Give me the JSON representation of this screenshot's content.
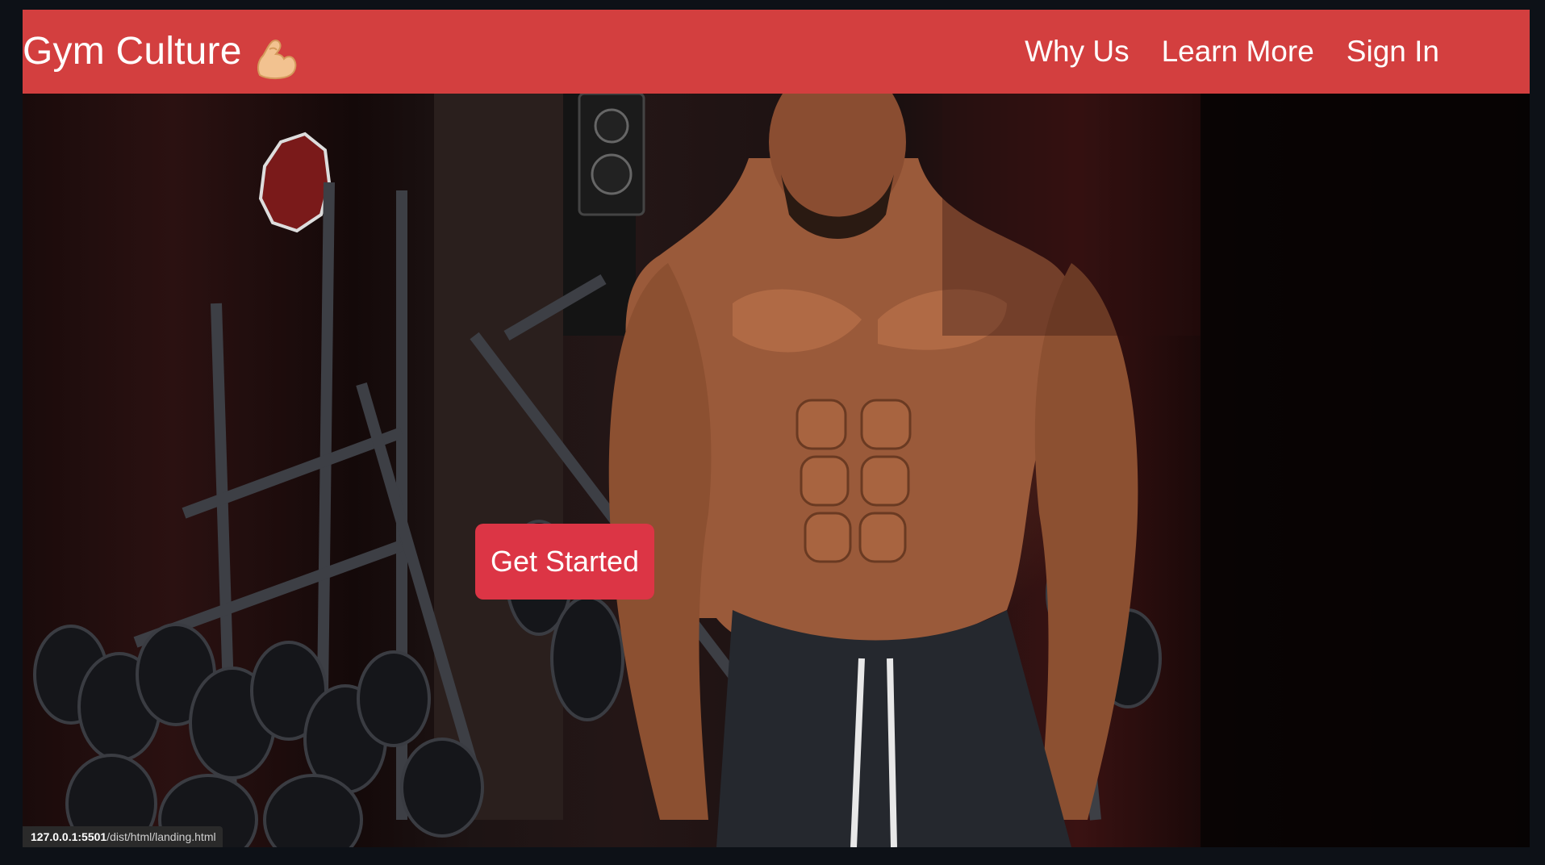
{
  "navbar": {
    "brand": "Gym Culture",
    "brand_icon": "flexed-biceps-icon",
    "links": [
      {
        "label": "Why Us"
      },
      {
        "label": "Learn More"
      },
      {
        "label": "Sign In"
      }
    ],
    "color": "#d33f3f"
  },
  "hero": {
    "cta_label": "Get Started",
    "cta_color": "#dc3545",
    "background": "gym-photo-bodybuilder"
  },
  "status_bar": {
    "host": "127.0.0.1:5501",
    "path": "/dist/html/landing.html"
  }
}
